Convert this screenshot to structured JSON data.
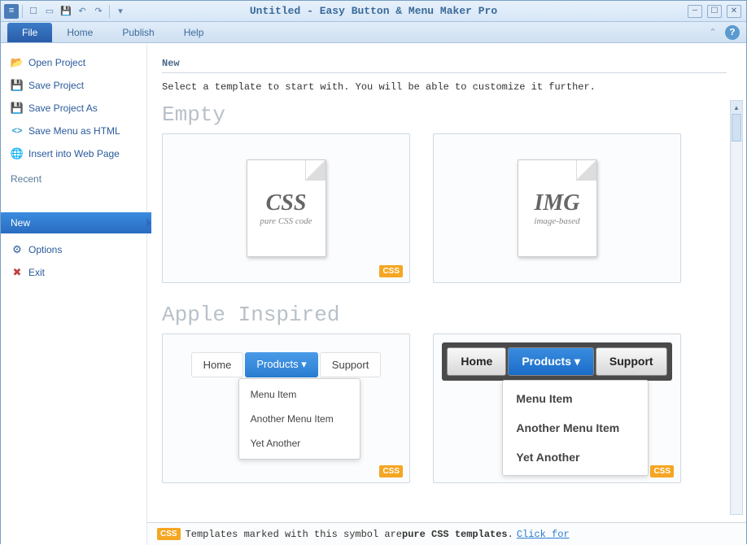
{
  "title": "Untitled - Easy Button & Menu Maker Pro",
  "ribbon": {
    "tabs": [
      "File",
      "Home",
      "Publish",
      "Help"
    ]
  },
  "sidebar": {
    "items": [
      {
        "icon": "📂",
        "label": "Open Project"
      },
      {
        "icon": "💾",
        "label": "Save Project"
      },
      {
        "icon": "💾",
        "label": "Save Project As"
      },
      {
        "icon": "<>",
        "label": "Save Menu as HTML"
      },
      {
        "icon": "🌐",
        "label": "Insert into Web Page"
      }
    ],
    "recent_label": "Recent",
    "new_label": "New",
    "options_label": "Options",
    "exit_label": "Exit"
  },
  "content": {
    "header": "New",
    "desc": "Select a template to start with. You will be able to customize it further.",
    "sections": [
      {
        "title": "Empty",
        "cards": [
          {
            "big": "CSS",
            "small": "pure CSS code",
            "badge": "CSS"
          },
          {
            "big": "IMG",
            "small": "image-based",
            "badge": ""
          }
        ]
      },
      {
        "title": "Apple Inspired",
        "menu_items": [
          "Home",
          "Products",
          "Support"
        ],
        "dropdown_items": [
          "Menu Item",
          "Another Menu Item",
          "Yet Another"
        ],
        "badge": "CSS"
      }
    ]
  },
  "footer": {
    "badge": "CSS",
    "text1": "Templates marked with this symbol are ",
    "bold": "pure CSS templates",
    "text2": ". ",
    "link": "Click for "
  }
}
